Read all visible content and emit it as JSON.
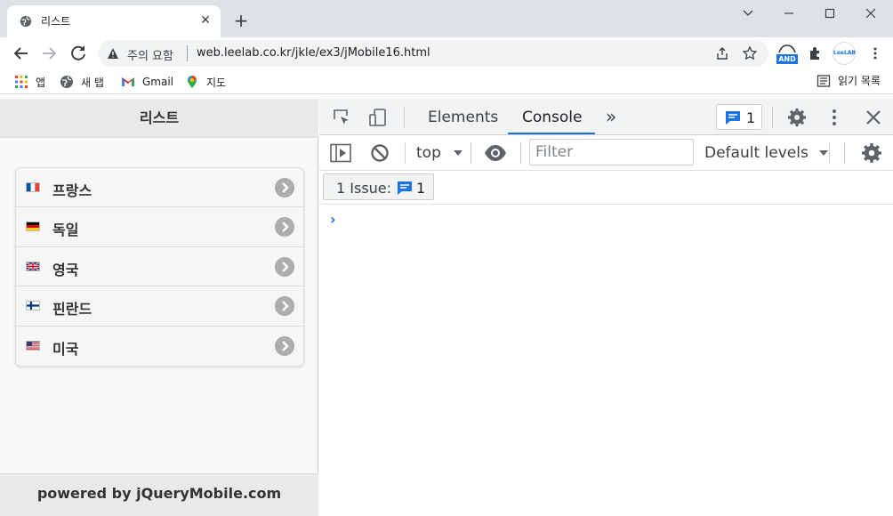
{
  "browser": {
    "tab": {
      "title": "리스트",
      "close": "✕"
    },
    "new_tab": "+",
    "window": {
      "minimize": "—",
      "maximize": "☐",
      "close": "✕"
    },
    "omnibox": {
      "security": "주의 요함",
      "url": "web.leelab.co.kr/jkle/ex3/jMobile16.html"
    },
    "extensions": {
      "and_badge": "AND",
      "leelab": "LeeLAB"
    },
    "bookmarks": [
      {
        "label": "앱",
        "icon": "apps-grid-icon"
      },
      {
        "label": "새 탭",
        "icon": "globe-icon"
      },
      {
        "label": "Gmail",
        "icon": "gmail-icon"
      },
      {
        "label": "지도",
        "icon": "maps-pin-icon"
      }
    ],
    "reading_list": "읽기 목록"
  },
  "page": {
    "header": "리스트",
    "items": [
      {
        "label": "프랑스",
        "flag": "france-flag-icon"
      },
      {
        "label": "독일",
        "flag": "germany-flag-icon"
      },
      {
        "label": "영국",
        "flag": "uk-flag-icon"
      },
      {
        "label": "핀란드",
        "flag": "finland-flag-icon"
      },
      {
        "label": "미국",
        "flag": "usa-flag-icon"
      }
    ],
    "footer": "powered by jQueryMobile.com"
  },
  "devtools": {
    "tabs": [
      "Elements",
      "Console"
    ],
    "active_tab": "Console",
    "more": "»",
    "issues_count": "1",
    "context": "top",
    "filter_placeholder": "Filter",
    "levels": "Default levels",
    "issue_label": "1 Issue:",
    "issue_count": "1",
    "prompt": "›",
    "accent": "#1a73e8"
  }
}
